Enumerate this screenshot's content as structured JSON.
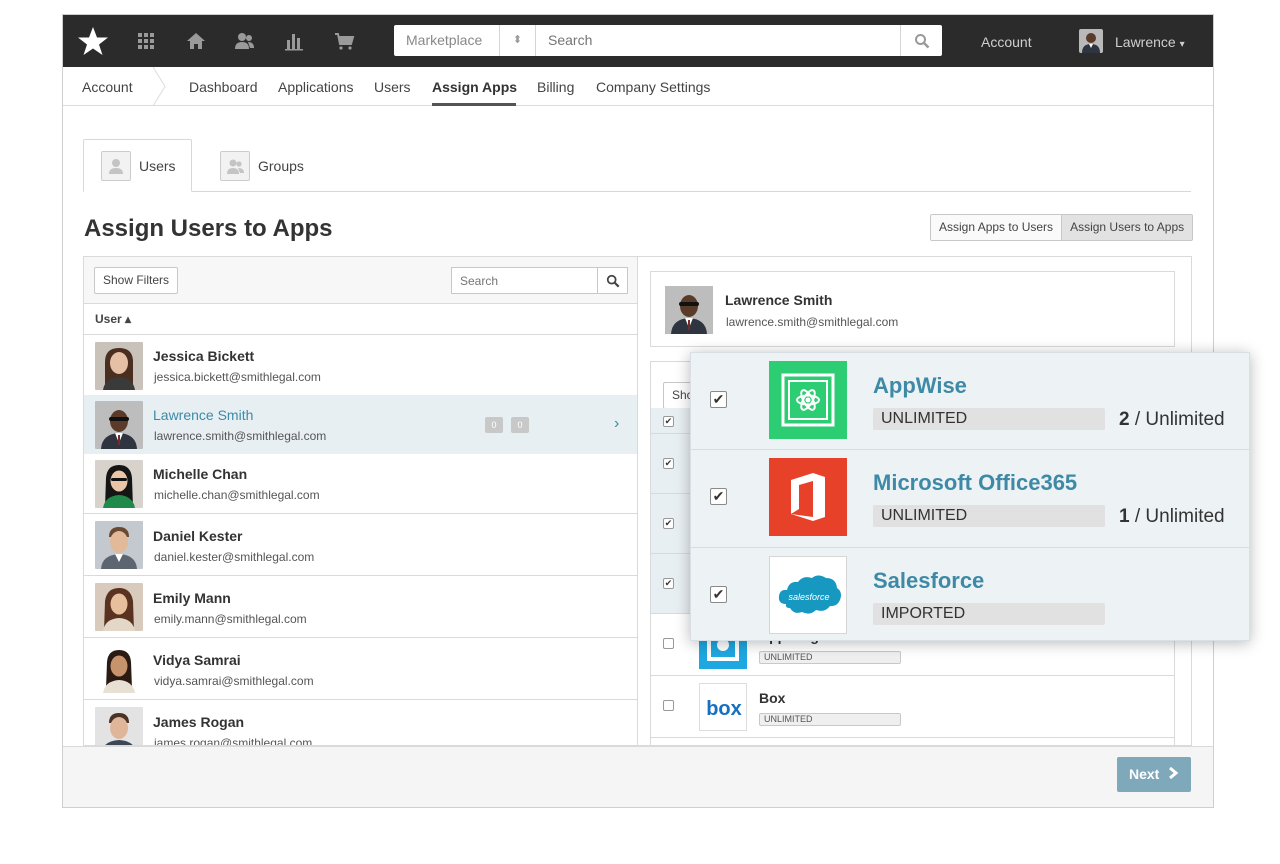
{
  "topbar": {
    "marketplace_label": "Marketplace",
    "search_placeholder": "Search",
    "account_label": "Account",
    "user_name": "Lawrence",
    "user_caret": "▾"
  },
  "subnav": {
    "items": [
      "Account",
      "Dashboard",
      "Applications",
      "Users",
      "Assign Apps",
      "Billing",
      "Company Settings"
    ],
    "active": "Assign Apps"
  },
  "tabs": {
    "users": "Users",
    "groups": "Groups"
  },
  "page_title": "Assign Users to Apps",
  "mode_toggle": {
    "option1": "Assign Apps to Users",
    "option2": "Assign Users to Apps",
    "selected": "Assign Users to Apps"
  },
  "left_panel": {
    "show_filters": "Show Filters",
    "search_placeholder": "Search",
    "column_header": "User ▴",
    "users": [
      {
        "name": "Jessica Bickett",
        "email": "jessica.bickett@smithlegal.com"
      },
      {
        "name": "Lawrence Smith",
        "email": "lawrence.smith@smithlegal.com",
        "badge1": "0",
        "badge2": "0",
        "selected": true
      },
      {
        "name": "Michelle Chan",
        "email": "michelle.chan@smithlegal.com"
      },
      {
        "name": "Daniel Kester",
        "email": "daniel.kester@smithlegal.com"
      },
      {
        "name": "Emily Mann",
        "email": "emily.mann@smithlegal.com"
      },
      {
        "name": "Vidya Samrai",
        "email": "vidya.samrai@smithlegal.com"
      },
      {
        "name": "James Rogan",
        "email": "james.rogan@smithlegal.com"
      }
    ]
  },
  "right_panel": {
    "selected_user": {
      "name": "Lawrence Smith",
      "email": "lawrence.smith@smithlegal.com"
    },
    "show_fragment": "Sho",
    "apps": [
      {
        "name": "AppInsights",
        "license": "UNLIMITED"
      },
      {
        "name": "Box",
        "license": "UNLIMITED"
      }
    ]
  },
  "popup": {
    "apps": [
      {
        "name": "AppWise",
        "license": "UNLIMITED",
        "used": "2",
        "total": "/ Unlimited",
        "checked": "✔"
      },
      {
        "name": "Microsoft Office365",
        "license": "UNLIMITED",
        "used": "1",
        "total": "/ Unlimited",
        "checked": "✔"
      },
      {
        "name": "Salesforce",
        "license": "IMPORTED",
        "checked": "✔",
        "logo_text": "salesforce"
      }
    ]
  },
  "footer": {
    "next_label": "Next"
  },
  "icons": {
    "logo": "star-icon",
    "nav": [
      "apps-grid-icon",
      "home-icon",
      "users-icon",
      "chart-icon",
      "cart-icon"
    ],
    "search": "search-icon",
    "next": "chevron-right-icon"
  },
  "colors": {
    "topbar": "#2b2b2b",
    "accent": "#3e8aa6",
    "next_button": "#7fa8bb",
    "appwise_green": "#2dcd73",
    "office_red": "#e8412a",
    "salesforce_blue": "#1798c1"
  }
}
